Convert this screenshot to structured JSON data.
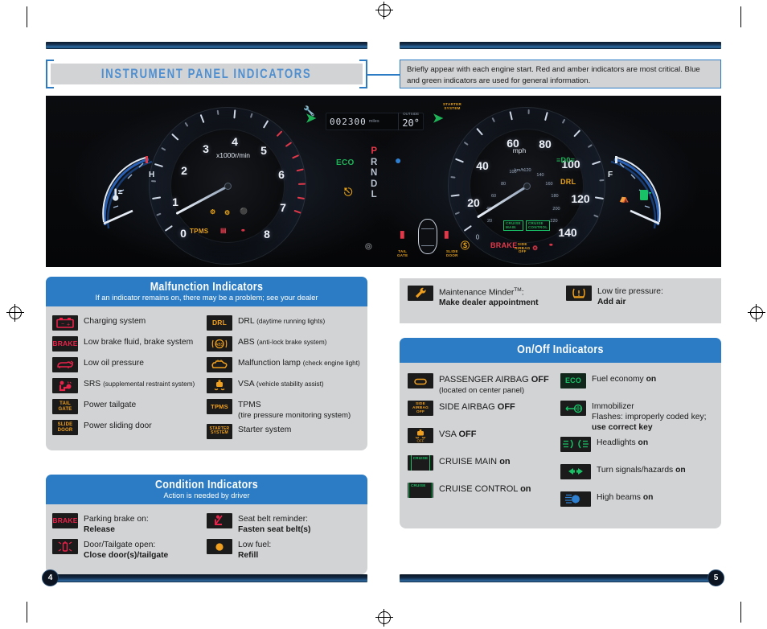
{
  "document": {
    "title": "INSTRUMENT PANEL INDICATORS",
    "intro_note": "Briefly appear with each engine start. Red and amber indicators are most critical. Blue and green indicators are used for general information.",
    "page_left": "4",
    "page_right": "5"
  },
  "cluster": {
    "tachometer": {
      "unit_label": "x1000r/min",
      "ticks": [
        "0",
        "1",
        "2",
        "3",
        "4",
        "5",
        "6",
        "7",
        "8"
      ],
      "redline_from": 6
    },
    "speedometer": {
      "unit_primary": "mph",
      "unit_secondary": "km/h",
      "mph_ticks": [
        "0",
        "20",
        "40",
        "60",
        "80",
        "100",
        "120",
        "140"
      ],
      "kmh_ticks": [
        "20",
        "40",
        "60",
        "80",
        "100",
        "120",
        "140",
        "160",
        "180",
        "200",
        "220"
      ]
    },
    "odometer": {
      "value": "002300",
      "unit": "miles"
    },
    "outside_temp": {
      "label": "OUTSIDE",
      "value": "20°"
    },
    "gear_display": [
      "P",
      "R",
      "N",
      "D",
      "L"
    ],
    "gear_selected": "P",
    "temp_gauge": {
      "high": "H"
    },
    "fuel_gauge": {
      "full": "F"
    },
    "lit_indicators": [
      "ECO",
      "DRL",
      "TPMS",
      "BRAKE",
      "STARTER SYSTEM",
      "TAIL GATE",
      "SLIDE DOOR",
      "SIDE AIRBAG OFF"
    ]
  },
  "malfunction": {
    "heading": "Malfunction Indicators",
    "subheading": "If an indicator remains on, there may be a problem; see your dealer",
    "left_items": [
      {
        "icon": "charging-system-icon",
        "glyph": "battery",
        "color": "#e8234a",
        "label": "Charging system",
        "note": ""
      },
      {
        "icon": "brake-system-icon",
        "glyph": "text",
        "text": "BRAKE",
        "color": "#e8234a",
        "label": "Low brake fluid, brake system",
        "note": ""
      },
      {
        "icon": "low-oil-pressure-icon",
        "glyph": "oilcan",
        "color": "#e8234a",
        "label": "Low oil pressure",
        "note": ""
      },
      {
        "icon": "srs-icon",
        "glyph": "srs",
        "color": "#e8234a",
        "label": "SRS",
        "note": "(supplemental restraint system)"
      },
      {
        "icon": "power-tailgate-icon",
        "glyph": "text2",
        "text": "TAIL|GATE",
        "color": "#f0a01e",
        "label": "Power tailgate",
        "note": ""
      },
      {
        "icon": "power-sliding-door-icon",
        "glyph": "text2",
        "text": "SLIDE|DOOR",
        "color": "#f0a01e",
        "label": "Power sliding door",
        "note": ""
      }
    ],
    "right_items": [
      {
        "icon": "drl-icon",
        "glyph": "text",
        "text": "DRL",
        "color": "#f0a01e",
        "label": "DRL",
        "note": "(daytime running lights)"
      },
      {
        "icon": "abs-icon",
        "glyph": "abs",
        "color": "#f0a01e",
        "label": "ABS",
        "note": "(anti-lock brake system)"
      },
      {
        "icon": "malfunction-lamp-icon",
        "glyph": "engine",
        "color": "#f0a01e",
        "label": "Malfunction lamp",
        "note": "(check engine light)"
      },
      {
        "icon": "vsa-icon",
        "glyph": "vsa",
        "color": "#f0a01e",
        "label": "VSA",
        "note": "(vehicle stability assist)"
      },
      {
        "icon": "tpms-icon",
        "glyph": "text",
        "text": "TPMS",
        "color": "#f0a01e",
        "label": "TPMS",
        "note": "(tire pressure monitoring system)",
        "note_newline": true
      },
      {
        "icon": "starter-system-icon",
        "glyph": "text2",
        "text": "STARTER|SYSTEM",
        "color": "#f0a01e",
        "label": "Starter system",
        "note": ""
      }
    ]
  },
  "condition": {
    "heading": "Condition Indicators",
    "subheading": "Action is needed by driver",
    "left_items": [
      {
        "icon": "parking-brake-icon",
        "glyph": "text",
        "text": "BRAKE",
        "color": "#e8234a",
        "label": "Parking brake on:",
        "action": "Release"
      },
      {
        "icon": "door-open-icon",
        "glyph": "door",
        "color": "#e8234a",
        "label": "Door/Tailgate open:",
        "action": "Close door(s)/tailgate"
      }
    ],
    "right_items": [
      {
        "icon": "seat-belt-reminder-icon",
        "glyph": "seatbelt",
        "color": "#e8234a",
        "label": "Seat belt reminder:",
        "action": "Fasten seat belt(s)"
      },
      {
        "icon": "low-fuel-icon",
        "glyph": "dot",
        "color": "#f0a01e",
        "label": "Low fuel:",
        "action": "Refill"
      }
    ]
  },
  "maintenance": {
    "items": [
      {
        "icon": "wrench-icon",
        "glyph": "wrench",
        "color": "#f0a01e",
        "label": "Maintenance Minder",
        "sup": "TM",
        "suffix": ":",
        "action": "Make dealer appointment"
      },
      {
        "icon": "low-tire-pressure-icon",
        "glyph": "tpms-horseshoe",
        "color": "#f0a01e",
        "label": "Low tire pressure:",
        "action": "Add air"
      }
    ]
  },
  "onoff": {
    "heading": "On/Off Indicators",
    "left_items": [
      {
        "icon": "passenger-airbag-off-icon",
        "glyph": "pill",
        "color": "#f0a01e",
        "label": "PASSENGER AIRBAG",
        "state": "OFF",
        "note": "(located on center panel)"
      },
      {
        "icon": "side-airbag-off-icon",
        "glyph": "text3",
        "text": "SIDE|AIRBAG|OFF",
        "color": "#f0a01e",
        "label": "SIDE AIRBAG",
        "state": "OFF",
        "note": ""
      },
      {
        "icon": "vsa-off-icon",
        "glyph": "vsaoff",
        "color": "#f0a01e",
        "label": "VSA",
        "state": "OFF",
        "note": ""
      },
      {
        "icon": "cruise-main-icon",
        "glyph": "text2box",
        "text": "CRUISE|MAIN",
        "color": "#19c267",
        "label": "CRUISE MAIN",
        "state": "on",
        "note": ""
      },
      {
        "icon": "cruise-control-icon",
        "glyph": "text2box",
        "text": "CRUISE|CONTROL",
        "color": "#19c267",
        "label": "CRUISE CONTROL",
        "state": "on",
        "note": ""
      }
    ],
    "right_items": [
      {
        "icon": "fuel-economy-icon",
        "glyph": "text",
        "text": "ECO",
        "color": "#19c267",
        "label": "Fuel economy",
        "state": "on",
        "note": ""
      },
      {
        "icon": "immobilizer-icon",
        "glyph": "key",
        "color": "#19c267",
        "label": "Immobilizer",
        "note": "Flashes: improperly coded key;",
        "action": "use correct key"
      },
      {
        "icon": "headlights-icon",
        "glyph": "headlight",
        "color": "#19c267",
        "label": "Headlights",
        "state": "on",
        "note": ""
      },
      {
        "icon": "turn-signal-icon",
        "glyph": "arrows",
        "color": "#19c267",
        "label": "Turn signals/hazards",
        "state": "on",
        "note": ""
      },
      {
        "icon": "high-beam-icon",
        "glyph": "highbeam",
        "color": "#2f7fd0",
        "label": "High beams",
        "state": "on",
        "note": ""
      }
    ]
  },
  "colors": {
    "accent_blue": "#2b7cc4",
    "panel_gray": "#d2d3d5",
    "warn_red": "#e8234a",
    "warn_amber": "#f0a01e",
    "ok_green": "#19c267"
  }
}
